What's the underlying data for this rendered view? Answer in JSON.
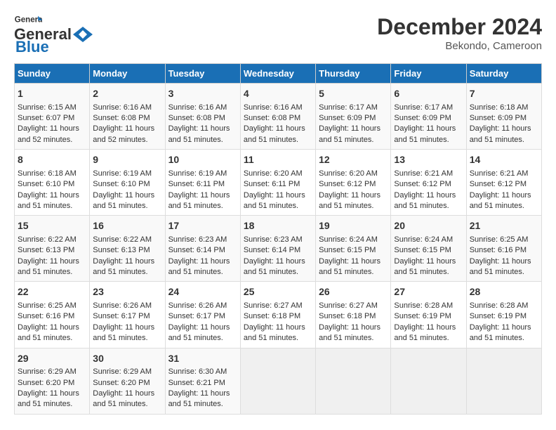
{
  "header": {
    "logo_line1": "General",
    "logo_line2": "Blue",
    "title": "December 2024",
    "subtitle": "Bekondo, Cameroon"
  },
  "days_of_week": [
    "Sunday",
    "Monday",
    "Tuesday",
    "Wednesday",
    "Thursday",
    "Friday",
    "Saturday"
  ],
  "weeks": [
    [
      {
        "day": 1,
        "rise": "6:15 AM",
        "set": "6:07 PM",
        "hours": "11",
        "mins": "52"
      },
      {
        "day": 2,
        "rise": "6:16 AM",
        "set": "6:08 PM",
        "hours": "11",
        "mins": "52"
      },
      {
        "day": 3,
        "rise": "6:16 AM",
        "set": "6:08 PM",
        "hours": "11",
        "mins": "51"
      },
      {
        "day": 4,
        "rise": "6:16 AM",
        "set": "6:08 PM",
        "hours": "11",
        "mins": "51"
      },
      {
        "day": 5,
        "rise": "6:17 AM",
        "set": "6:09 PM",
        "hours": "11",
        "mins": "51"
      },
      {
        "day": 6,
        "rise": "6:17 AM",
        "set": "6:09 PM",
        "hours": "11",
        "mins": "51"
      },
      {
        "day": 7,
        "rise": "6:18 AM",
        "set": "6:09 PM",
        "hours": "11",
        "mins": "51"
      }
    ],
    [
      {
        "day": 8,
        "rise": "6:18 AM",
        "set": "6:10 PM",
        "hours": "11",
        "mins": "51"
      },
      {
        "day": 9,
        "rise": "6:19 AM",
        "set": "6:10 PM",
        "hours": "11",
        "mins": "51"
      },
      {
        "day": 10,
        "rise": "6:19 AM",
        "set": "6:11 PM",
        "hours": "11",
        "mins": "51"
      },
      {
        "day": 11,
        "rise": "6:20 AM",
        "set": "6:11 PM",
        "hours": "11",
        "mins": "51"
      },
      {
        "day": 12,
        "rise": "6:20 AM",
        "set": "6:12 PM",
        "hours": "11",
        "mins": "51"
      },
      {
        "day": 13,
        "rise": "6:21 AM",
        "set": "6:12 PM",
        "hours": "11",
        "mins": "51"
      },
      {
        "day": 14,
        "rise": "6:21 AM",
        "set": "6:12 PM",
        "hours": "11",
        "mins": "51"
      }
    ],
    [
      {
        "day": 15,
        "rise": "6:22 AM",
        "set": "6:13 PM",
        "hours": "11",
        "mins": "51"
      },
      {
        "day": 16,
        "rise": "6:22 AM",
        "set": "6:13 PM",
        "hours": "11",
        "mins": "51"
      },
      {
        "day": 17,
        "rise": "6:23 AM",
        "set": "6:14 PM",
        "hours": "11",
        "mins": "51"
      },
      {
        "day": 18,
        "rise": "6:23 AM",
        "set": "6:14 PM",
        "hours": "11",
        "mins": "51"
      },
      {
        "day": 19,
        "rise": "6:24 AM",
        "set": "6:15 PM",
        "hours": "11",
        "mins": "51"
      },
      {
        "day": 20,
        "rise": "6:24 AM",
        "set": "6:15 PM",
        "hours": "11",
        "mins": "51"
      },
      {
        "day": 21,
        "rise": "6:25 AM",
        "set": "6:16 PM",
        "hours": "11",
        "mins": "51"
      }
    ],
    [
      {
        "day": 22,
        "rise": "6:25 AM",
        "set": "6:16 PM",
        "hours": "11",
        "mins": "51"
      },
      {
        "day": 23,
        "rise": "6:26 AM",
        "set": "6:17 PM",
        "hours": "11",
        "mins": "51"
      },
      {
        "day": 24,
        "rise": "6:26 AM",
        "set": "6:17 PM",
        "hours": "11",
        "mins": "51"
      },
      {
        "day": 25,
        "rise": "6:27 AM",
        "set": "6:18 PM",
        "hours": "11",
        "mins": "51"
      },
      {
        "day": 26,
        "rise": "6:27 AM",
        "set": "6:18 PM",
        "hours": "11",
        "mins": "51"
      },
      {
        "day": 27,
        "rise": "6:28 AM",
        "set": "6:19 PM",
        "hours": "11",
        "mins": "51"
      },
      {
        "day": 28,
        "rise": "6:28 AM",
        "set": "6:19 PM",
        "hours": "11",
        "mins": "51"
      }
    ],
    [
      {
        "day": 29,
        "rise": "6:29 AM",
        "set": "6:20 PM",
        "hours": "11",
        "mins": "51"
      },
      {
        "day": 30,
        "rise": "6:29 AM",
        "set": "6:20 PM",
        "hours": "11",
        "mins": "51"
      },
      {
        "day": 31,
        "rise": "6:30 AM",
        "set": "6:21 PM",
        "hours": "11",
        "mins": "51"
      },
      null,
      null,
      null,
      null
    ]
  ]
}
